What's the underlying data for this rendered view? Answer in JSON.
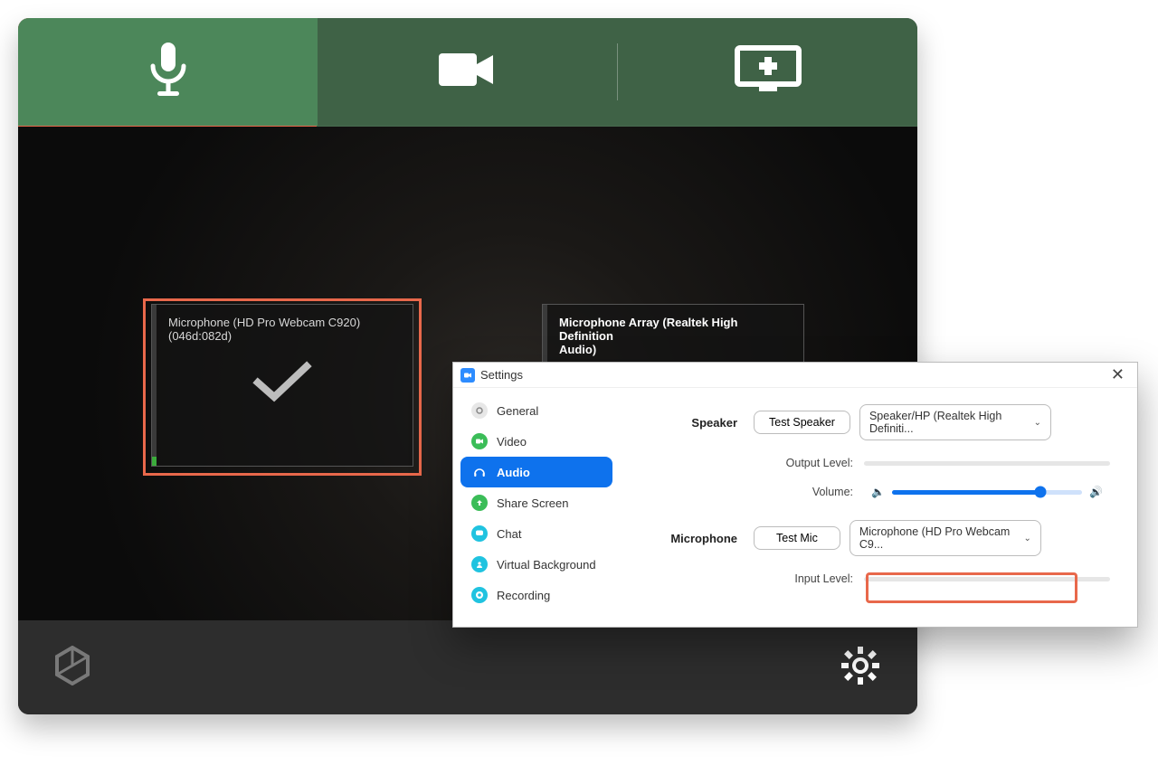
{
  "tabs": {
    "audio": "audio",
    "video": "video",
    "share": "share"
  },
  "mic_left": {
    "line1": "Microphone (HD Pro Webcam C920)",
    "line2": "(046d:082d)"
  },
  "mic_right": {
    "line1": "Microphone Array (Realtek High Definition",
    "line2": "Audio)"
  },
  "settings": {
    "title": "Settings",
    "sidebar": {
      "general": "General",
      "video": "Video",
      "audio": "Audio",
      "share": "Share Screen",
      "chat": "Chat",
      "vbg": "Virtual Background",
      "rec": "Recording"
    },
    "speaker": {
      "label": "Speaker",
      "test": "Test Speaker",
      "selected": "Speaker/HP (Realtek High Definiti...",
      "output_label": "Output Level:",
      "volume_label": "Volume:"
    },
    "microphone": {
      "label": "Microphone",
      "test": "Test Mic",
      "selected": "Microphone (HD Pro Webcam C9...",
      "input_label": "Input Level:"
    }
  }
}
